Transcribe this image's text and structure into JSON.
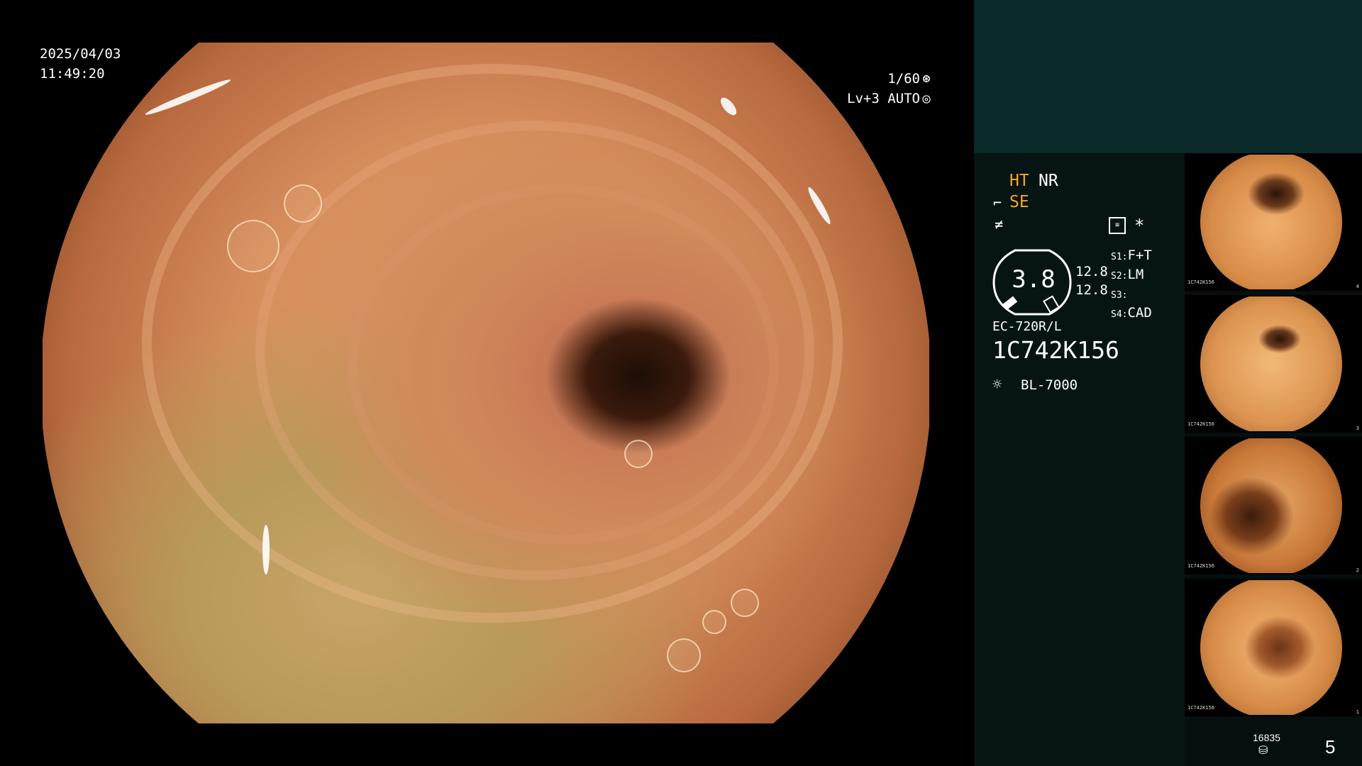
{
  "overlay": {
    "date": "2025/04/03",
    "time": "11:49:20",
    "shutter": "1/60",
    "shutter_icon": "shutter-icon",
    "level": "Lv+3",
    "exposure_mode": "AUTO",
    "exposure_icon": "iris-icon"
  },
  "panel": {
    "ht": "HT",
    "nr": "NR",
    "se": "SE",
    "settings_icon_symbol": "*",
    "zoom_value": "3.8",
    "value_a": "12.8",
    "value_b": "12.8",
    "switches": [
      {
        "key": "S1",
        "value": "F+T"
      },
      {
        "key": "S2",
        "value": "LM"
      },
      {
        "key": "S3",
        "value": ""
      },
      {
        "key": "S4",
        "value": "CAD"
      }
    ],
    "scope_model": "EC-720R/L",
    "serial": "1C742K156",
    "light_source": "BL-7000",
    "storage_count": "16835",
    "image_count": "5"
  },
  "thumbnails": [
    {
      "index": "4",
      "serial": "1C742K156"
    },
    {
      "index": "3",
      "serial": "1C742K156"
    },
    {
      "index": "2",
      "serial": "1C742K156"
    },
    {
      "index": "1",
      "serial": "1C742K156"
    }
  ],
  "colors": {
    "accent_orange": "#f5a623",
    "panel_top": "#0b2a2a",
    "panel_bg": "#071414"
  }
}
